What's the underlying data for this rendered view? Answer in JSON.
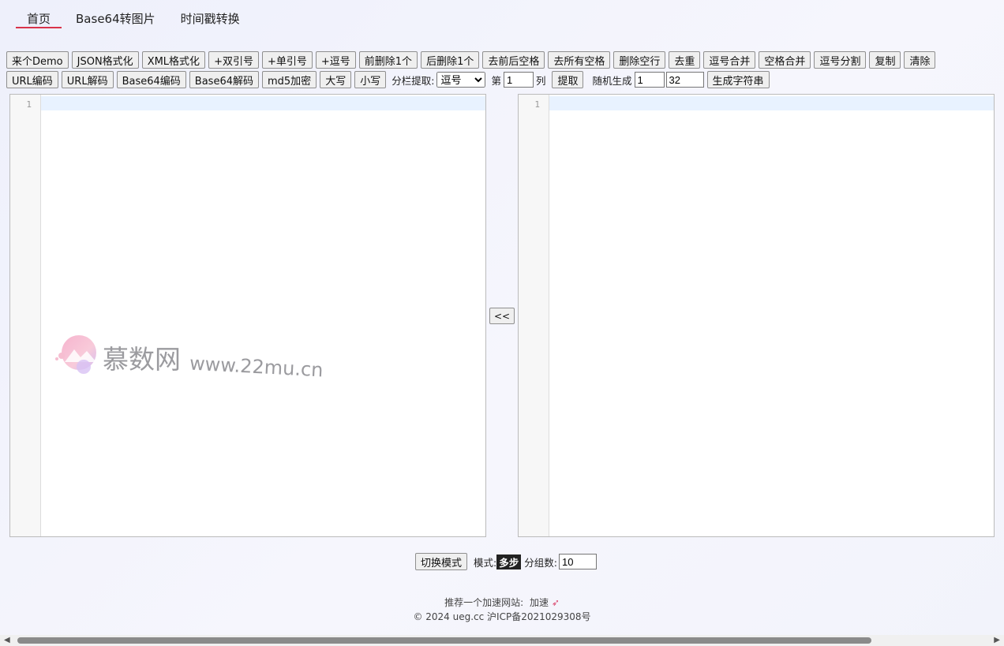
{
  "nav": {
    "tabs": [
      {
        "label": "首页"
      },
      {
        "label": "Base64转图片"
      },
      {
        "label": "时间戳转换"
      }
    ]
  },
  "toolbar1": {
    "buttons": [
      "来个Demo",
      "JSON格式化",
      "XML格式化",
      "+双引号",
      "+单引号",
      "+逗号",
      "前删除1个",
      "后删除1个",
      "去前后空格",
      "去所有空格",
      "删除空行",
      "去重",
      "逗号合并",
      "空格合并",
      "逗号分割",
      "复制",
      "清除"
    ]
  },
  "toolbar2": {
    "buttons": [
      "URL编码",
      "URL解码",
      "Base64编码",
      "Base64解码",
      "md5加密",
      "大写",
      "小写"
    ],
    "split_label": "分栏提取:",
    "split_selected": "逗号",
    "col_prefix": "第",
    "col_value": "1",
    "col_suffix": "列",
    "extract_button": "提取",
    "random_label": "随机生成",
    "random_count": "1",
    "random_length": "32",
    "generate_button": "生成字符串"
  },
  "editors": {
    "left": {
      "line_number": "1"
    },
    "right": {
      "line_number": "1"
    },
    "transfer_button": "<<"
  },
  "watermark": {
    "brand": "慕数网",
    "url": "www.22mu.cn"
  },
  "bottom": {
    "switch_button": "切换模式",
    "mode_label": "模式:",
    "mode_value": "多步",
    "group_label": "分组数:",
    "group_value": "10"
  },
  "footer": {
    "recommend": "推荐一个加速网站:",
    "link": "加速",
    "copyright": "© 2024 ueg.cc 沪ICP备2021029308号"
  },
  "colors": {
    "accent": "#d9334a",
    "active_line": "#e8f2ff"
  }
}
